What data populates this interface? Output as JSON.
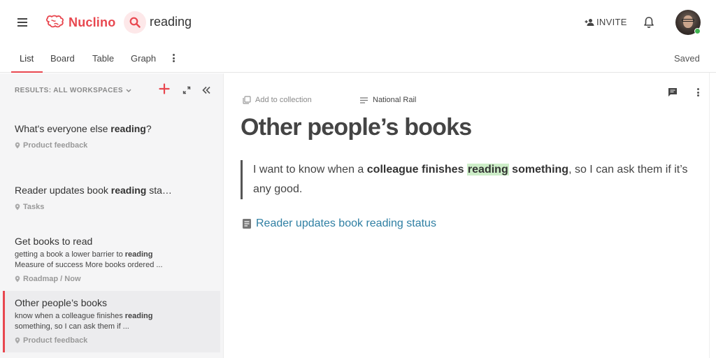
{
  "header": {
    "brand": "Nuclino",
    "search_query": "reading",
    "invite_label": "INVITE",
    "icons": {
      "menu": "hamburger-icon",
      "logo": "brain-icon",
      "search": "search-icon",
      "invite": "add-person-icon",
      "notifications": "bell-icon"
    },
    "colors": {
      "brand": "#e8474f",
      "search_bg": "#fde8e9",
      "online": "#3fb34f"
    }
  },
  "tabs": {
    "items": [
      {
        "label": "List",
        "active": true
      },
      {
        "label": "Board",
        "active": false
      },
      {
        "label": "Table",
        "active": false
      },
      {
        "label": "Graph",
        "active": false
      }
    ],
    "status": "Saved"
  },
  "sidebar": {
    "results_label": "RESULTS: ALL WORKSPACES",
    "items": [
      {
        "title_pre": "What's everyone else ",
        "title_bold": "reading",
        "title_post": "?",
        "location": "Product feedback",
        "active": false
      },
      {
        "title_pre": "Reader updates book ",
        "title_bold": "reading",
        "title_post": " sta…",
        "location": "Tasks",
        "active": false
      },
      {
        "title": "Get books to read",
        "snippet1_pre": "getting a book a lower barrier to ",
        "snippet1_bold": "reading",
        "snippet2": "Measure of success More books ordered ...",
        "location": "Roadmap / Now",
        "active": false
      },
      {
        "title": "Other people’s books",
        "snippet1_pre": "know when a colleague finishes ",
        "snippet1_bold": "reading",
        "snippet2": "something, so I can ask them if ...",
        "location": "Product feedback",
        "active": true
      }
    ]
  },
  "document": {
    "add_collection_label": "Add to collection",
    "collection": "National Rail",
    "title": "Other people’s books",
    "quote": {
      "part1": "I want to know when a ",
      "bold1": "colleague finishes ",
      "highlight": "reading",
      "bold2": " something",
      "part2": ", so I can ask them if it’s any good."
    },
    "link_label": "Reader updates book reading status",
    "colors": {
      "highlight": "#cdeec8",
      "link": "#2f7fa3"
    }
  }
}
